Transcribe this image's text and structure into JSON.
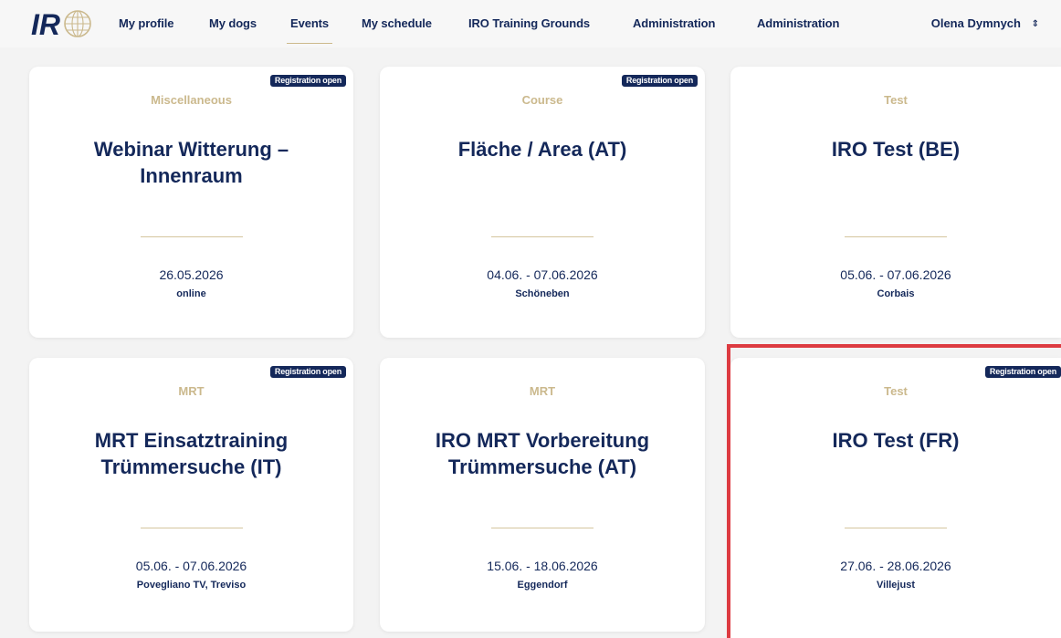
{
  "nav": {
    "items": [
      "My profile",
      "My dogs",
      "Events",
      "My schedule",
      "IRO Training Grounds",
      "Administration",
      "Administration"
    ],
    "active": "Events",
    "user_name": "Olena Dymnych",
    "user_chevron": "⇕"
  },
  "colors": {
    "navy": "#14285a",
    "gold": "#cbb98d",
    "highlight_red": "#dd3b41"
  },
  "events": [
    {
      "badge": "Registration open",
      "category": "Miscellaneous",
      "title": "Webinar Witterung – Innenraum",
      "date": "26.05.2026",
      "location": "online"
    },
    {
      "badge": "Registration open",
      "category": "Course",
      "title": "Fläche / Area (AT)",
      "date": "04.06. - 07.06.2026",
      "location": "Schöneben"
    },
    {
      "badge": "",
      "category": "Test",
      "title": "IRO Test (BE)",
      "date": "05.06. - 07.06.2026",
      "location": "Corbais"
    },
    {
      "badge": "Registration open",
      "category": "MRT",
      "title": "MRT Einsatztraining Trümmersuche (IT)",
      "date": "05.06. - 07.06.2026",
      "location": "Povegliano TV, Treviso"
    },
    {
      "badge": "",
      "category": "MRT",
      "title": "IRO MRT Vorbereitung Trümmersuche (AT)",
      "date": "15.06. - 18.06.2026",
      "location": "Eggendorf"
    },
    {
      "badge": "Registration open",
      "category": "Test",
      "title": "IRO Test (FR)",
      "date": "27.06. - 28.06.2026",
      "location": "Villejust"
    }
  ]
}
